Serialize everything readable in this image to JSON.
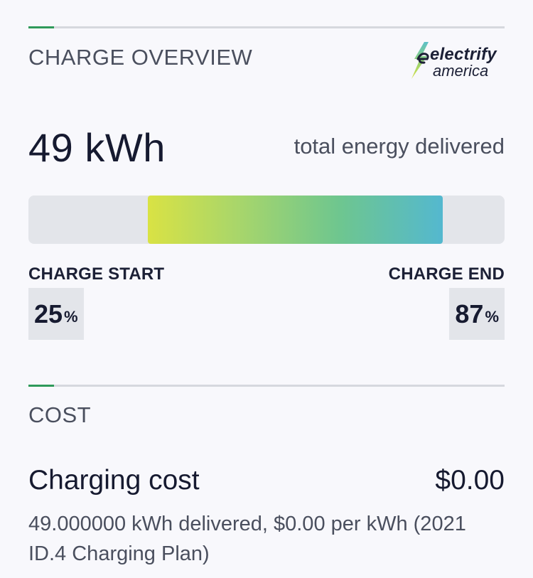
{
  "overview": {
    "title": "CHARGE OVERVIEW",
    "logo": {
      "name": "electrify-america-logo",
      "line1": "electrify",
      "line2": "america"
    },
    "energy_value": "49 kWh",
    "energy_label": "total energy delivered",
    "charge_bar": {
      "start_percent": 25,
      "end_percent": 87,
      "gradient_colors": [
        "#d9e244",
        "#6ec68f",
        "#54b8cf"
      ],
      "track_color": "#e3e5ea"
    },
    "charge_start": {
      "label": "CHARGE START",
      "value": "25",
      "unit": "%"
    },
    "charge_end": {
      "label": "CHARGE END",
      "value": "87",
      "unit": "%"
    }
  },
  "cost": {
    "title": "COST",
    "label": "Charging cost",
    "value": "$0.00",
    "detail": "49.000000 kWh delivered, $0.00 per kWh (2021 ID.4 Charging Plan)"
  },
  "colors": {
    "accent": "#2f9a5a",
    "background": "#f8f8fc",
    "text_primary": "#161a30",
    "text_secondary": "#4a4f5e"
  }
}
